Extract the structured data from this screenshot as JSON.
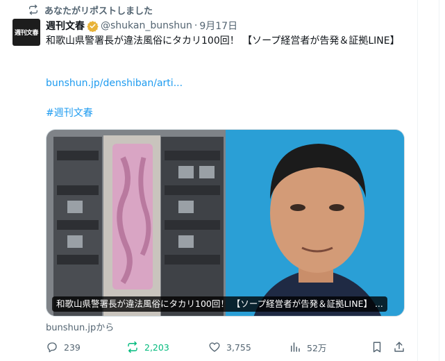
{
  "colors": {
    "accent": "#1d9bf0",
    "text_primary": "#0f1419",
    "text_secondary": "#536471",
    "repost_active": "#00ba7c",
    "verified_gold": "#e8b339"
  },
  "repost_banner": {
    "icon": "repost-icon",
    "text": "あなたがリポストしました"
  },
  "author": {
    "avatar_text": "週刊文春",
    "name": "週刊文春",
    "verified_icon": "verified-gold-badge-icon",
    "handle": "@shukan_bunshun",
    "separator": "·",
    "date": "9月17日"
  },
  "tweet": {
    "text": "和歌山県警署長が違法風俗にタカリ100回！ 【ソープ経営者が告発＆証拠LINE】",
    "link": "bunshun.jp/denshiban/arti...",
    "hashtag": "#週刊文春"
  },
  "card": {
    "caption": "和歌山県警署長が違法風俗にタカリ100回！ 【ソープ経営者が告発＆証拠LINE】 ...",
    "source": "bunshun.jpから"
  },
  "actions": {
    "reply": {
      "icon": "reply-icon",
      "count": "239"
    },
    "repost": {
      "icon": "repost-icon",
      "count": "2,203"
    },
    "like": {
      "icon": "heart-icon",
      "count": "3,755"
    },
    "views": {
      "icon": "bar-chart-icon",
      "count": "52万"
    },
    "bookmark": {
      "icon": "bookmark-icon"
    },
    "share": {
      "icon": "share-icon"
    }
  }
}
